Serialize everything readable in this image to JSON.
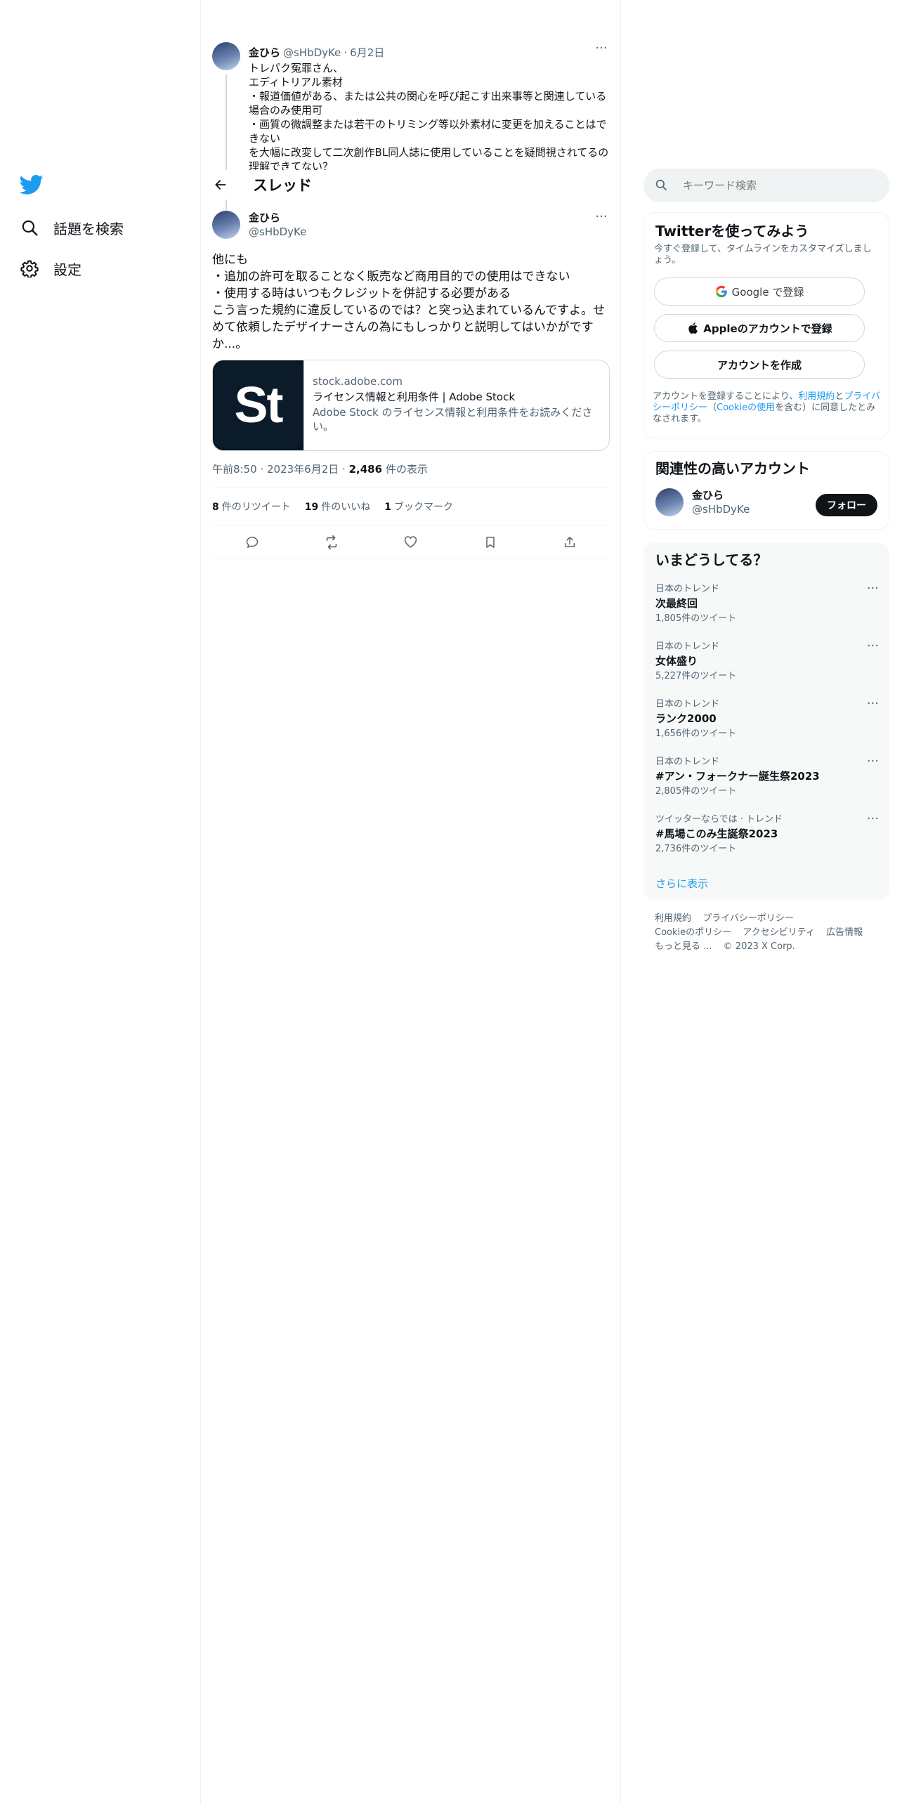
{
  "nav": {
    "items": [
      {
        "label": "話題を検索",
        "icon": "search-icon"
      },
      {
        "label": "設定",
        "icon": "gear-icon"
      }
    ],
    "brand_color": "#1d9bf0"
  },
  "header": {
    "title": "スレッド"
  },
  "prev_tweet": {
    "name": "金ひら",
    "handle": "@sHbDyKe",
    "dot": "·",
    "date": "6月2日",
    "lines": [
      "トレパク冤罪さん、",
      "エディトリアル素材",
      "・報道価値がある、または公共の関心を呼び起こす出来事等と関連している場合のみ使用可",
      "・画質の微調整または若干のトリミング等以外素材に変更を加えることはできない",
      "を大幅に改変して二次創作BL同人誌に使用していることを疑問視されてるの理解できてない？"
    ]
  },
  "focus_tweet": {
    "name": "金ひら",
    "handle": "@sHbDyKe",
    "lines": [
      "他にも",
      "・追加の許可を取ることなく販売など商用目的での使用はできない",
      "・使用する時はいつもクレジットを併記する必要がある",
      "こう言った規約に違反しているのでは？と突っ込まれているんですよ。せめて依頼したデザイナーさんの為にもしっかりと説明してはいかがですか...。"
    ],
    "card": {
      "logo_text": "St",
      "domain": "stock.adobe.com",
      "title": "ライセンス情報と利用条件 | Adobe Stock",
      "description": "Adobe Stock のライセンス情報と利用条件をお読みください。"
    },
    "time": "午前8:50",
    "date": "2023年6月2日",
    "views": "2,486",
    "views_label": "件の表示",
    "retweets": "8",
    "retweets_label": "件のリツイート",
    "likes": "19",
    "likes_label": "件のいいね",
    "bookmarks": "1",
    "bookmarks_label": "ブックマーク"
  },
  "search": {
    "placeholder": "キーワード検索"
  },
  "signup": {
    "title": "Twitterを使ってみよう",
    "subtitle": "今すぐ登録して、タイムラインをカスタマイズしましょう。",
    "google_label": "Google で登録",
    "apple_label": "Appleのアカウントで登録",
    "create_label": "アカウントを作成",
    "legal_prefix": "アカウントを登録することにより、",
    "legal_terms": "利用規約",
    "legal_and": "と",
    "legal_privacy": "プライバシーポリシー",
    "legal_paren_open": "（",
    "legal_cookie": "Cookieの使用",
    "legal_suffix": "を含む）に同意したとみなされます。"
  },
  "related": {
    "title": "関連性の高いアカウント",
    "name": "金ひら",
    "handle": "@sHbDyKe",
    "follow_label": "フォロー"
  },
  "trends": {
    "title": "いまどうしてる？",
    "items": [
      {
        "context": "日本のトレンド",
        "name": "次最終回",
        "count": "1,805件のツイート"
      },
      {
        "context": "日本のトレンド",
        "name": "女体盛り",
        "count": "5,227件のツイート"
      },
      {
        "context": "日本のトレンド",
        "name": "ランク2000",
        "count": "1,656件のツイート"
      },
      {
        "context": "日本のトレンド",
        "name": "#アン・フォークナー誕生祭2023",
        "count": "2,805件のツイート"
      },
      {
        "context": "ツイッターならでは · トレンド",
        "name": "#馬場このみ生誕祭2023",
        "count": "2,736件のツイート"
      }
    ],
    "show_more": "さらに表示"
  },
  "footer": {
    "links": [
      "利用規約",
      "プライバシーポリシー",
      "Cookieのポリシー",
      "アクセシビリティ",
      "広告情報",
      "もっと見る ..."
    ],
    "copyright": "© 2023 X Corp."
  }
}
